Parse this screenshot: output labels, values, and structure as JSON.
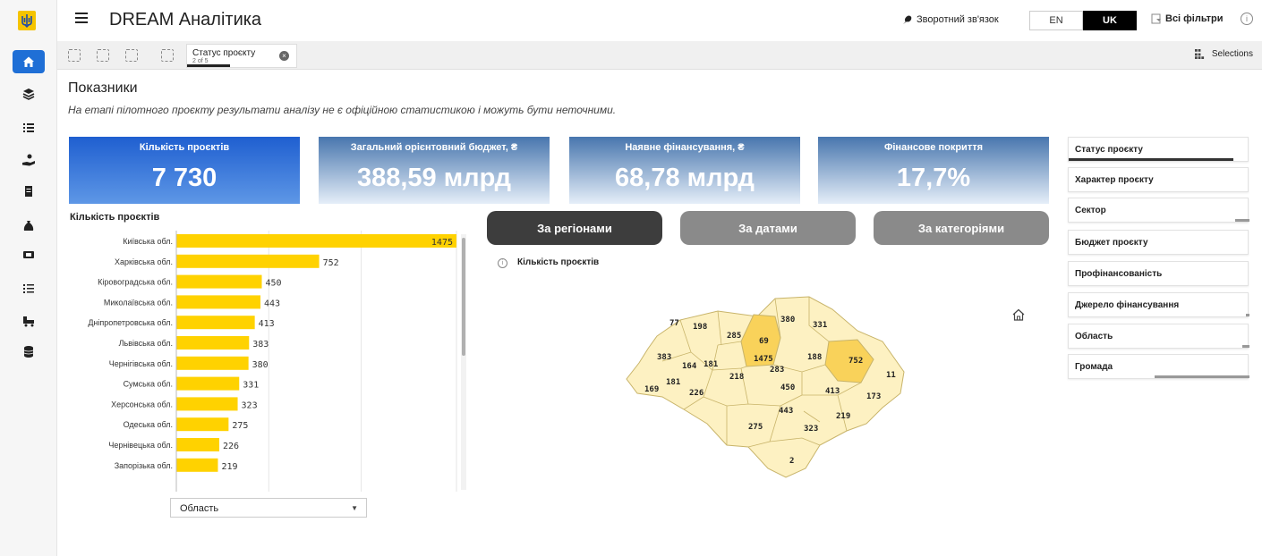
{
  "header": {
    "app_title": "DREAM Аналітика",
    "feedback": "Зворотний зв'язок",
    "lang_en": "EN",
    "lang_uk": "UK",
    "all_filters": "Всі фільтри"
  },
  "selection_bar": {
    "chip_title": "Статус проєкту",
    "chip_sub": "2 of 5",
    "selections_label": "Selections"
  },
  "page": {
    "title": "Показники",
    "disclaimer": "На етапі пілотного проєкту результати аналізу не є офіційною статистикою і можуть бути неточними."
  },
  "kpis": [
    {
      "title": "Кількість проєктів",
      "value": "7 730"
    },
    {
      "title": "Загальний орієнтовний бюджет, ₴",
      "value": "388,59 млрд"
    },
    {
      "title": "Наявне фінансування, ₴",
      "value": "68,78 млрд"
    },
    {
      "title": "Фінансове покриття",
      "value": "17,7%"
    }
  ],
  "chart_data": {
    "type": "bar",
    "orientation": "horizontal",
    "title": "Кількість проєктів",
    "categories": [
      "Київська обл.",
      "Харківська обл.",
      "Кіровоградська обл.",
      "Миколаївська обл.",
      "Дніпропетровська обл.",
      "Львівська обл.",
      "Чернігівська обл.",
      "Сумська обл.",
      "Херсонська обл.",
      "Одеська обл.",
      "Чернівецька обл.",
      "Запорізька обл."
    ],
    "values": [
      1475,
      752,
      450,
      443,
      413,
      383,
      380,
      331,
      323,
      275,
      226,
      219
    ],
    "value_labels": [
      "1475",
      "752",
      "450",
      "443",
      "413",
      "383",
      "380",
      "331",
      "323",
      "275",
      "226",
      "219"
    ],
    "xlim": [
      0,
      1475
    ],
    "bar_color": "#ffd200",
    "grid": true
  },
  "dimension_select": "Область",
  "tabs": [
    {
      "label": "За регіонами",
      "active": true
    },
    {
      "label": "За датами",
      "active": false
    },
    {
      "label": "За категоріями",
      "active": false
    }
  ],
  "map": {
    "title": "Кількість проєктів",
    "labels": [
      "77",
      "198",
      "285",
      "69",
      "380",
      "331",
      "383",
      "164",
      "181",
      "1475",
      "188",
      "752",
      "11",
      "169",
      "181",
      "226",
      "218",
      "283",
      "450",
      "413",
      "173",
      "443",
      "219",
      "275",
      "323",
      "2"
    ]
  },
  "filters": [
    {
      "label": "Статус проєкту",
      "bar": "dark"
    },
    {
      "label": "Характер проєкту",
      "bar": ""
    },
    {
      "label": "Сектор",
      "bar": "grey-right"
    },
    {
      "label": "Бюджет проєкту",
      "bar": ""
    },
    {
      "label": "Профінансованість",
      "bar": ""
    },
    {
      "label": "Джерело фінансування",
      "bar": "grey-tick"
    },
    {
      "label": "Область",
      "bar": "grey-tick"
    },
    {
      "label": "Громада",
      "bar": "grey-right"
    }
  ],
  "colors": {
    "accent": "#1f6fd6",
    "bar": "#ffd200",
    "map_fill": "#fdf1c2",
    "map_highlight": "#f9d25a",
    "tab_active": "#3d3d3d",
    "tab_inactive": "#8a8a8a"
  },
  "icons": {
    "rail": [
      "home-icon",
      "layers-icon",
      "list-icon",
      "hand-coin-icon",
      "document-icon",
      "money-bag-icon",
      "screen-icon",
      "numbered-list-icon",
      "truck-icon",
      "database-icon"
    ]
  }
}
